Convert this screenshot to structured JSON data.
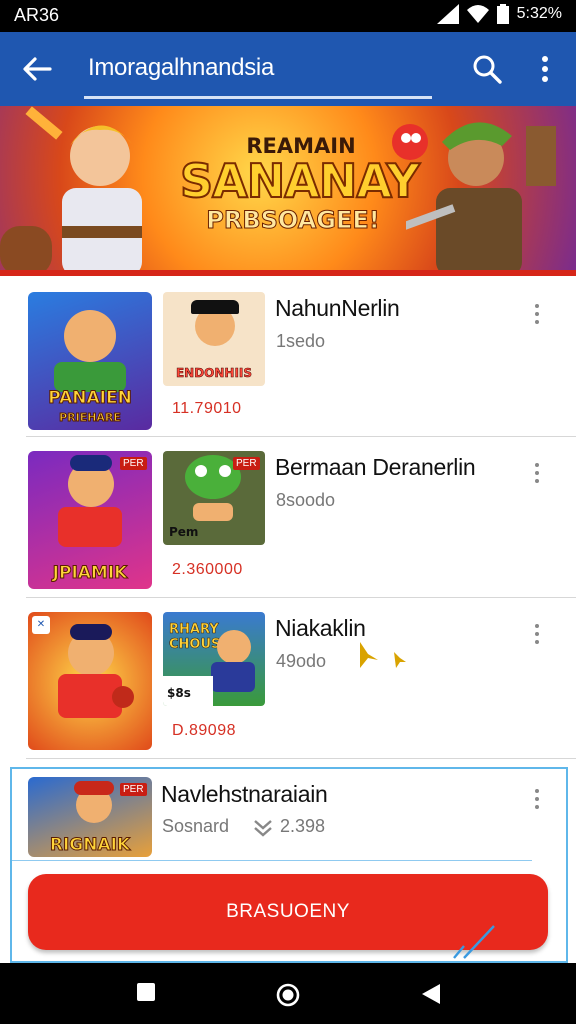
{
  "status_bar": {
    "time": "AR36",
    "battery": "5:32%"
  },
  "app_bar": {
    "title": "Imoragalhnandsia"
  },
  "banner": {
    "line1": "REAMAIN",
    "line2": "SANANAY",
    "line3": "PRBSOAGEE!"
  },
  "list": [
    {
      "name": "NahunNerlin",
      "sub": "1sedo",
      "thumb1_caption": "PANAIEN",
      "thumb1_caption2": "PRIEHARE",
      "thumb2_caption": "ENDONHIIS",
      "price": "11.79010"
    },
    {
      "name": "Bermaan Deranerlin",
      "sub": "8soodo",
      "thumb1_caption": "JPIAMIK",
      "thumb2_caption": "Pem",
      "price": "2.360000"
    },
    {
      "name": "Niakaklin",
      "sub": "49odo",
      "thumb1_caption": "",
      "thumb2_caption": "RHARY CHOUS",
      "thumb2_sub": "$8s",
      "price": "D.89098"
    },
    {
      "name": "Navlehstnaraiain",
      "sub": "Sosnard",
      "rating": "2.398",
      "thumb1_caption": "RIGNAIK"
    }
  ],
  "cta": {
    "label": "BRASUOENY"
  },
  "colors": {
    "app_bar": "#1f57b0",
    "accent_red": "#e8291d",
    "price_red": "#d63024"
  }
}
